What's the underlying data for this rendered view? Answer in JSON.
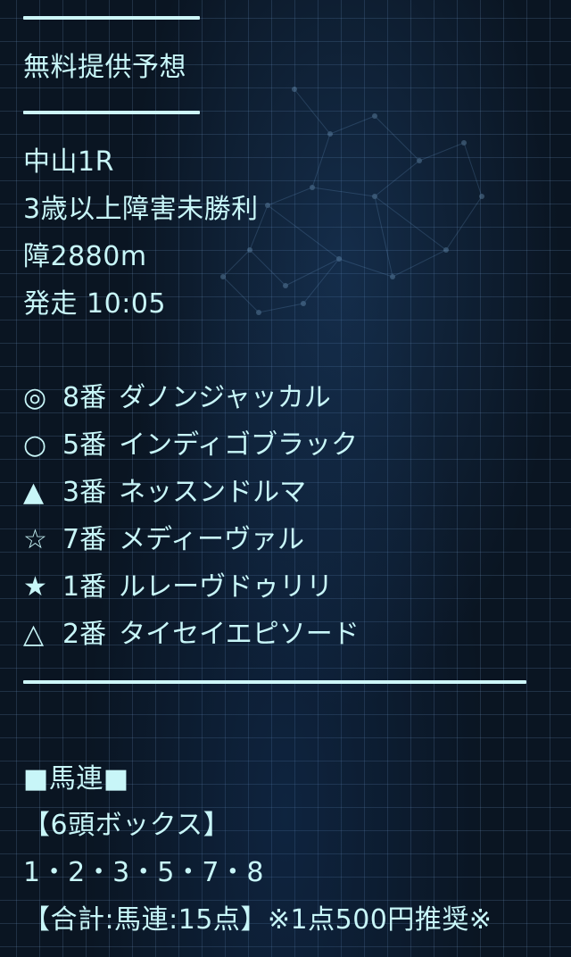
{
  "header": {
    "title": "無料提供予想"
  },
  "race": {
    "name": "中山1R",
    "class": "3歳以上障害未勝利",
    "distance": "障2880m",
    "start_time": "発走 10:05"
  },
  "picks": [
    {
      "mark": "◎",
      "number": "8番",
      "horse": "ダノンジャッカル"
    },
    {
      "mark": "○",
      "number": "5番",
      "horse": "インディゴブラック"
    },
    {
      "mark": "▲",
      "number": "3番",
      "horse": "ネッスンドルマ"
    },
    {
      "mark": "☆",
      "number": "7番",
      "horse": "メディーヴァル"
    },
    {
      "mark": "★",
      "number": "1番",
      "horse": "ルレーヴドゥリリ"
    },
    {
      "mark": "△",
      "number": "2番",
      "horse": "タイセイエピソード"
    }
  ],
  "bet": {
    "type": "■馬連■",
    "format": "【6頭ボックス】",
    "combination": "1・2・3・5・7・8",
    "total": "【合計:馬連:15点】※1点500円推奨※"
  }
}
